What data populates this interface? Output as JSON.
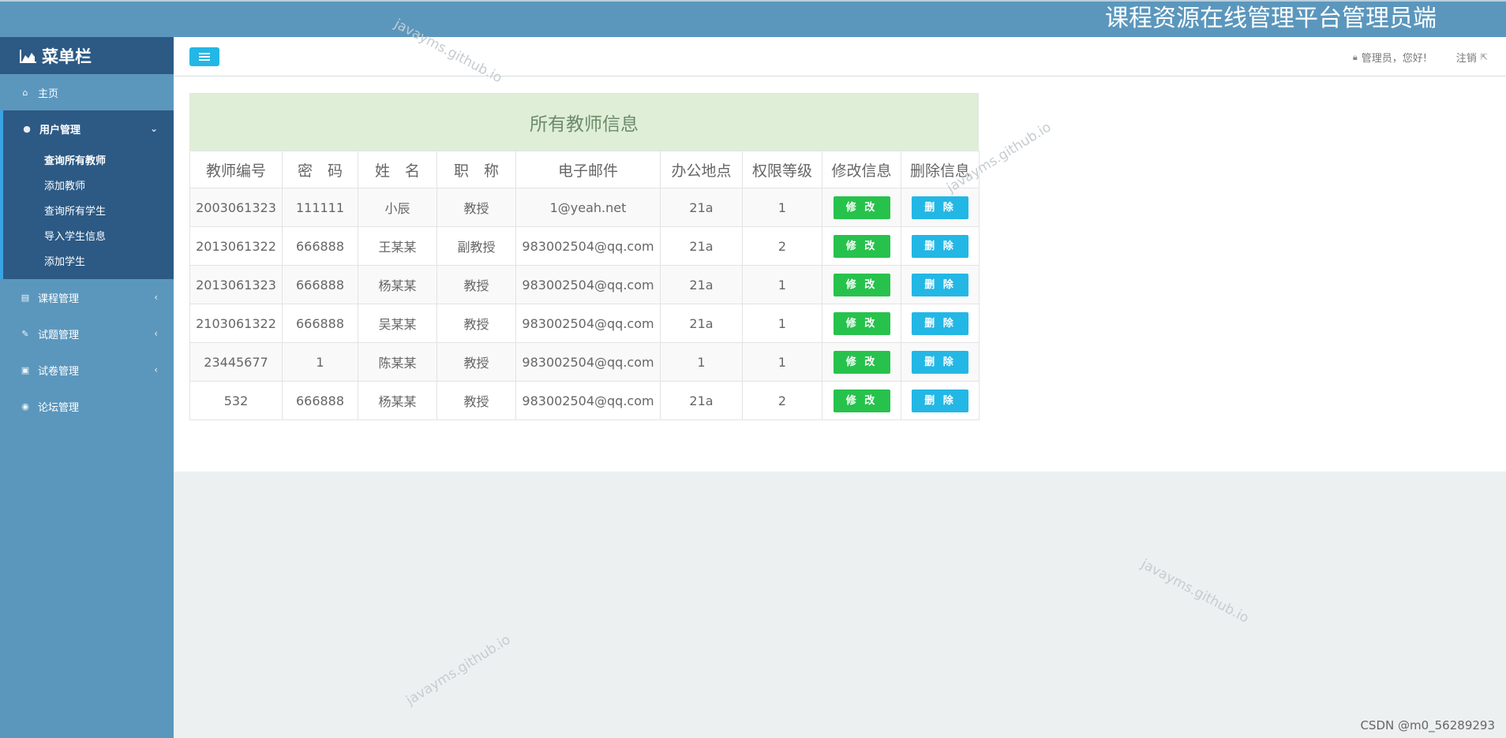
{
  "banner": {
    "title": "课程资源在线管理平台管理员端"
  },
  "sidebar": {
    "title": "菜单栏",
    "home": "主页",
    "user_mgmt": {
      "label": "用户管理",
      "items": [
        "查询所有教师",
        "添加教师",
        "查询所有学生",
        "导入学生信息",
        "添加学生"
      ]
    },
    "course_mgmt": "课程管理",
    "question_mgmt": "试题管理",
    "paper_mgmt": "试卷管理",
    "forum_mgmt": "论坛管理"
  },
  "topbar": {
    "greeting": "管理员，您好!",
    "logout": "注销"
  },
  "table": {
    "title": "所有教师信息",
    "headers": [
      "教师编号",
      "密　码",
      "姓　名",
      "职　称",
      "电子邮件",
      "办公地点",
      "权限等级",
      "修改信息",
      "删除信息"
    ],
    "edit_label": "修 改",
    "delete_label": "删 除",
    "rows": [
      [
        "2003061323",
        "111111",
        "小辰",
        "教授",
        "1@yeah.net",
        "21a",
        "1"
      ],
      [
        "2013061322",
        "666888",
        "王某某",
        "副教授",
        "983002504@qq.com",
        "21a",
        "2"
      ],
      [
        "2013061323",
        "666888",
        "杨某某",
        "教授",
        "983002504@qq.com",
        "21a",
        "1"
      ],
      [
        "2103061322",
        "666888",
        "吴某某",
        "教授",
        "983002504@qq.com",
        "21a",
        "1"
      ],
      [
        "23445677",
        "1",
        "陈某某",
        "教授",
        "983002504@qq.com",
        "1",
        "1"
      ],
      [
        "532",
        "666888",
        "杨某某",
        "教授",
        "983002504@qq.com",
        "21a",
        "2"
      ]
    ]
  },
  "watermark": {
    "text": "javayms.github.io",
    "csdn": "CSDN @m0_56289293"
  },
  "colors": {
    "banner": "#5b97bd",
    "sidebar_dark": "#2c5a85",
    "edit": "#27c24c",
    "delete": "#23b7e5",
    "panel_head": "#dfeed7"
  }
}
